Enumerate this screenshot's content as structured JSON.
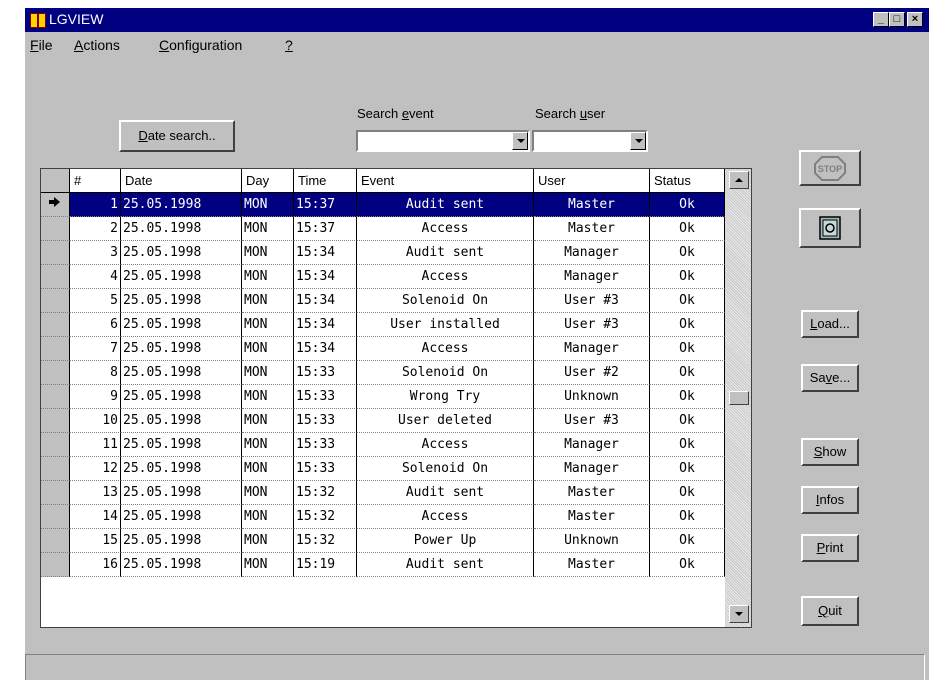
{
  "window": {
    "title": "LGVIEW"
  },
  "menu": [
    {
      "label": "File",
      "key": "F",
      "rest": "ile"
    },
    {
      "label": "Actions",
      "key": "A",
      "rest": "ctions"
    },
    {
      "label": "Configuration",
      "key": "C",
      "rest": "onfiguration"
    },
    {
      "label": "?",
      "key": "?",
      "rest": ""
    }
  ],
  "toolbar": {
    "date_search": {
      "key": "D",
      "rest": "ate search.."
    },
    "search_event_label": {
      "pre": "Search ",
      "key": "e",
      "rest": "vent"
    },
    "search_user_label": {
      "pre": "Search ",
      "key": "u",
      "rest": "ser"
    },
    "search_event_value": "",
    "search_user_value": ""
  },
  "table": {
    "columns": [
      "#",
      "Date",
      "Day",
      "Time",
      "Event",
      "User",
      "Status"
    ],
    "selected_index": 0,
    "rows": [
      [
        "1",
        "25.05.1998",
        "MON",
        "15:37",
        "Audit sent",
        "Master",
        "Ok"
      ],
      [
        "2",
        "25.05.1998",
        "MON",
        "15:37",
        "Access",
        "Master",
        "Ok"
      ],
      [
        "3",
        "25.05.1998",
        "MON",
        "15:34",
        "Audit sent",
        "Manager",
        "Ok"
      ],
      [
        "4",
        "25.05.1998",
        "MON",
        "15:34",
        "Access",
        "Manager",
        "Ok"
      ],
      [
        "5",
        "25.05.1998",
        "MON",
        "15:34",
        "Solenoid On",
        "User #3",
        "Ok"
      ],
      [
        "6",
        "25.05.1998",
        "MON",
        "15:34",
        "User installed",
        "User #3",
        "Ok"
      ],
      [
        "7",
        "25.05.1998",
        "MON",
        "15:34",
        "Access",
        "Manager",
        "Ok"
      ],
      [
        "8",
        "25.05.1998",
        "MON",
        "15:33",
        "Solenoid On",
        "User #2",
        "Ok"
      ],
      [
        "9",
        "25.05.1998",
        "MON",
        "15:33",
        "Wrong Try",
        "Unknown",
        "Ok"
      ],
      [
        "10",
        "25.05.1998",
        "MON",
        "15:33",
        "User deleted",
        "User #3",
        "Ok"
      ],
      [
        "11",
        "25.05.1998",
        "MON",
        "15:33",
        "Access",
        "Manager",
        "Ok"
      ],
      [
        "12",
        "25.05.1998",
        "MON",
        "15:33",
        "Solenoid On",
        "Manager",
        "Ok"
      ],
      [
        "13",
        "25.05.1998",
        "MON",
        "15:32",
        "Audit sent",
        "Master",
        "Ok"
      ],
      [
        "14",
        "25.05.1998",
        "MON",
        "15:32",
        "Access",
        "Master",
        "Ok"
      ],
      [
        "15",
        "25.05.1998",
        "MON",
        "15:32",
        "Power Up",
        "Unknown",
        "Ok"
      ],
      [
        "16",
        "25.05.1998",
        "MON",
        "15:19",
        "Audit sent",
        "Master",
        "Ok"
      ]
    ]
  },
  "side_buttons": {
    "stop_label": "STOP",
    "load": {
      "key": "L",
      "rest": "oad..."
    },
    "save": {
      "pre": "Sa",
      "key": "v",
      "rest": "e..."
    },
    "show": {
      "key": "S",
      "rest": "how"
    },
    "infos": {
      "key": "I",
      "rest": "nfos"
    },
    "print": {
      "key": "P",
      "rest": "rint"
    },
    "quit": {
      "key": "Q",
      "rest": "uit"
    }
  },
  "status_bar": {
    "text": ""
  }
}
